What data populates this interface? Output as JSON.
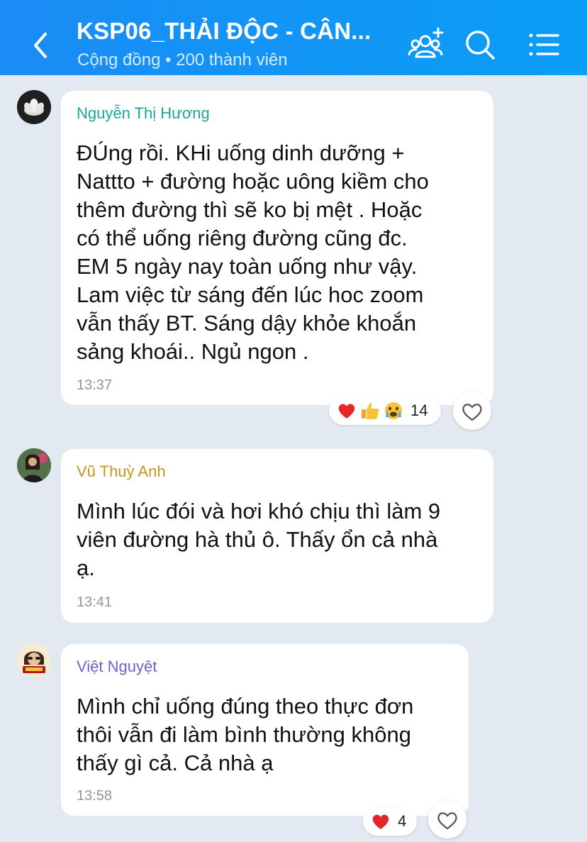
{
  "header": {
    "title": "KSP06_THẢI ĐỘC - CÂN...",
    "subtitle": "Cộng đồng • 200 thành viên"
  },
  "messages": [
    {
      "sender": "Nguyễn Thị Hương",
      "sender_color": "#1aa79a",
      "text": "ĐÚng rồi. KHi uống dinh dưỡng  +\nNattto  + đường hoặc uông kiềm cho\nthêm đường thì sẽ ko bị mệt . Hoặc\ncó thể uống riêng đường cũng đc.\nEM 5 ngày nay toàn  uống như vậy.\nLam việc từ sáng đến lúc hoc zoom\nvẫn thấy BT. Sáng dậy khỏe khoắn\nsảng khoái.. Ngủ ngon .",
      "time": "13:37",
      "reactions": {
        "icons": [
          "heart-emoji",
          "thumbs-up-emoji",
          "crying-face-emoji"
        ],
        "count": "14"
      }
    },
    {
      "sender": "Vũ Thuỳ Anh",
      "sender_color": "#c9941a",
      "text": "Mình lúc đói và hơi khó chịu thì làm 9\nviên đường hà thủ ô. Thấy ổn cả nhà\nạ.",
      "time": "13:41"
    },
    {
      "sender": "Việt Nguyệt",
      "sender_color": "#6b63c7",
      "text": "Mình chỉ uống đúng theo thực đơn\nthôi vẫn đi làm bình thường không\nthấy gì cả. Cả nhà ạ",
      "time": "13:58",
      "reactions": {
        "icons": [
          "heart-emoji"
        ],
        "count": "4"
      }
    }
  ],
  "icons": {
    "back": "chevron-left-icon",
    "add_member": "add-member-icon",
    "search": "search-icon",
    "menu": "menu-list-icon",
    "like": "heart-outline-icon"
  },
  "colors": {
    "header": "#1a8cf5",
    "background": "#e2e9f1",
    "bubble": "#ffffff"
  }
}
